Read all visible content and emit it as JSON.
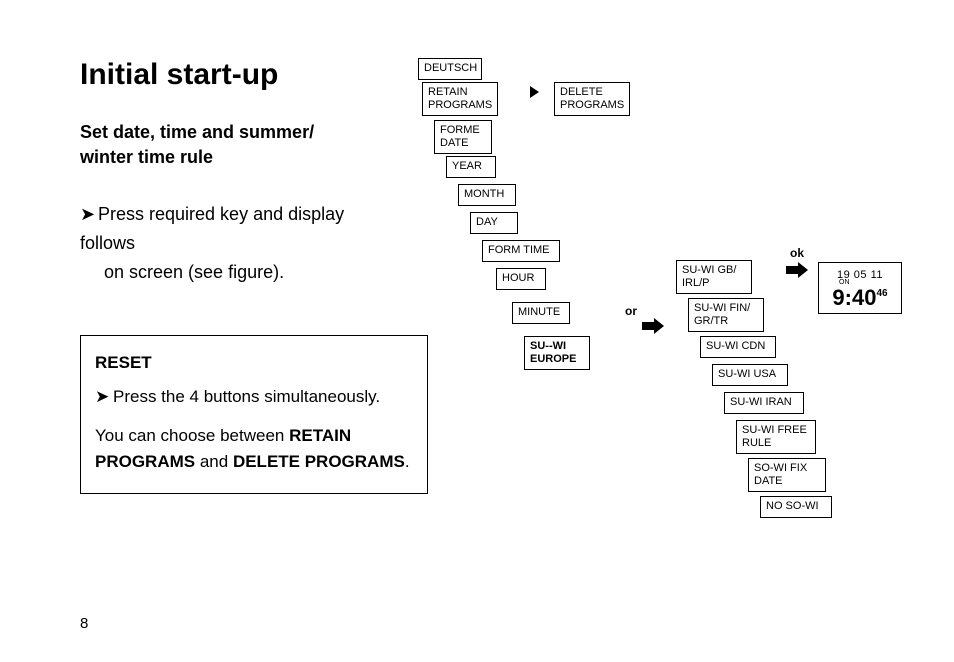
{
  "page_number": "8",
  "title": "Initial start-up",
  "subtitle": "Set date, time and summer/ winter time rule",
  "body_line1_pre": "Press required key and display follows",
  "body_line2": "on screen (see figure).",
  "reset": {
    "label": "RESET",
    "line1_pre": "Press the 4 buttons simultaneously.",
    "line2_a": "You can choose between ",
    "line2_b": "RETAIN PROGRAMS",
    "line2_c": " and ",
    "line2_d": "DELETE PROGRAMS",
    "line2_e": "."
  },
  "flow": {
    "deutsch": "DEUTSCH",
    "retain_programs": "RETAIN PROGRAMS",
    "delete_programs": "DELETE PROGRAMS",
    "forme_date": "FORME DATE",
    "year": "YEAR",
    "month": "MONTH",
    "day": "DAY",
    "form_time": "FORM TIME",
    "hour": "HOUR",
    "minute": "MINUTE",
    "su_wi_europe": "SU--WI EUROPE",
    "or": "or",
    "ok": "ok",
    "opts": {
      "gb": "SU-WI GB/ IRL/P",
      "fin": "SU-WI FIN/ GR/TR",
      "cdn": "SU-WI CDN",
      "usa": "SU-WI USA",
      "iran": "SU-WI IRAN",
      "free": "SU-WI FREE RULE",
      "fix": "SO-WI FIX DATE",
      "no": "NO SO-WI"
    },
    "time": {
      "top": "19   05   11",
      "on": "ON",
      "big_main": "9:40",
      "big_sec": "46"
    }
  }
}
